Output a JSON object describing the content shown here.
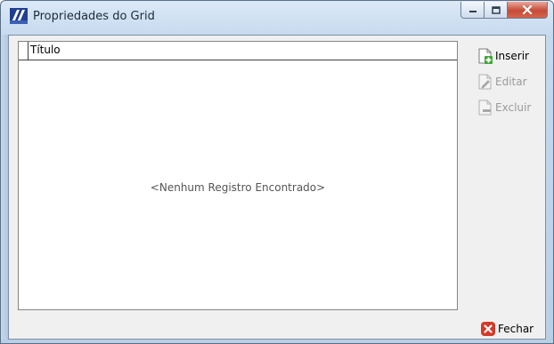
{
  "window": {
    "title": "Propriedades do Grid",
    "app_icon": "app-logo-icon",
    "controls": [
      "minimize-icon",
      "maximize-icon",
      "close-icon"
    ],
    "colors": {
      "frame": "#c5d9ee",
      "close_button": "#c64b36"
    }
  },
  "grid": {
    "columns": [
      "Título"
    ],
    "empty_message": "<Nenhum Registro Encontrado>"
  },
  "actions": {
    "inserir": {
      "label": "Inserir",
      "icon": "new-document-icon",
      "enabled": true
    },
    "editar": {
      "label": "Editar",
      "icon": "edit-document-icon",
      "enabled": false
    },
    "excluir": {
      "label": "Excluir",
      "icon": "delete-document-icon",
      "enabled": false
    },
    "fechar": {
      "label": "Fechar",
      "icon": "close-circle-icon",
      "enabled": true
    }
  }
}
